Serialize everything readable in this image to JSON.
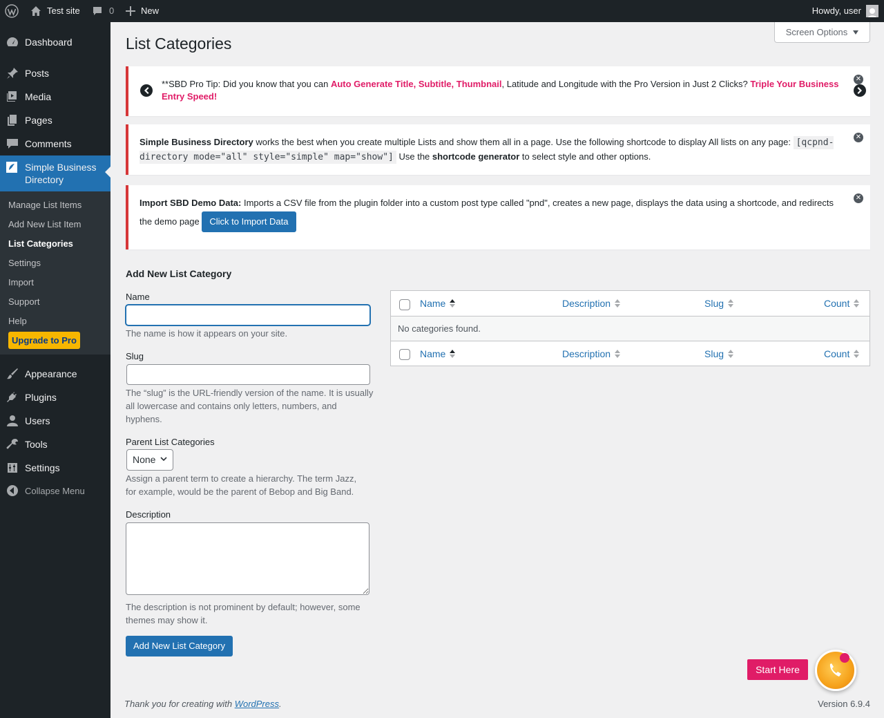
{
  "adminbar": {
    "site_name": "Test site",
    "comments_count": "0",
    "new_label": "New",
    "howdy": "Howdy, user"
  },
  "sidebar": {
    "items": [
      {
        "label": "Dashboard",
        "icon": "dashboard-icon"
      },
      {
        "label": "Posts",
        "icon": "pin-icon"
      },
      {
        "label": "Media",
        "icon": "media-icon"
      },
      {
        "label": "Pages",
        "icon": "pages-icon"
      },
      {
        "label": "Comments",
        "icon": "comment-icon"
      },
      {
        "label": "Simple Business Directory",
        "icon": "directory-icon"
      },
      {
        "label": "Appearance",
        "icon": "brush-icon"
      },
      {
        "label": "Plugins",
        "icon": "plug-icon"
      },
      {
        "label": "Users",
        "icon": "user-icon"
      },
      {
        "label": "Tools",
        "icon": "wrench-icon"
      },
      {
        "label": "Settings",
        "icon": "settings-icon"
      },
      {
        "label": "Collapse Menu",
        "icon": "collapse-icon"
      }
    ],
    "submenu": [
      "Manage List Items",
      "Add New List Item",
      "List Categories",
      "Settings",
      "Import",
      "Support",
      "Help"
    ],
    "upgrade_label": "Upgrade to Pro"
  },
  "screen_options": "Screen Options",
  "page_title": "List Categories",
  "notices": {
    "protip": {
      "prefix": "**SBD Pro Tip: Did you know that you can ",
      "highlight1": "Auto Generate Title, Subtitle, Thumbnail",
      "middle": ", Latitude and Longitude with the Pro Version in Just 2 Clicks? ",
      "highlight2": "Triple Your Business Entry Speed!"
    },
    "shortcode": {
      "strong": "Simple Business Directory",
      "text1": " works the best when you create multiple Lists and show them all in a page. Use the following shortcode to display All lists on any page: ",
      "code": "[qcpnd-directory mode=\"all\" style=\"simple\" map=\"show\"]",
      "text2": " Use the ",
      "strong2": "shortcode generator",
      "text3": " to select style and other options."
    },
    "import": {
      "strong": "Import SBD Demo Data:",
      "text": " Imports a CSV file from the plugin folder into a custom post type called \"pnd\", creates a new page, displays the data using a shortcode, and redirects the demo page ",
      "button": "Click to Import Data"
    }
  },
  "form": {
    "title": "Add New List Category",
    "name_label": "Name",
    "name_value": "",
    "name_help": "The name is how it appears on your site.",
    "slug_label": "Slug",
    "slug_value": "",
    "slug_help": "The “slug” is the URL-friendly version of the name. It is usually all lowercase and contains only letters, numbers, and hyphens.",
    "parent_label": "Parent List Categories",
    "parent_value": "None",
    "parent_help": "Assign a parent term to create a hierarchy. The term Jazz, for example, would be the parent of Bebop and Big Band.",
    "desc_label": "Description",
    "desc_value": "",
    "desc_help": "The description is not prominent by default; however, some themes may show it.",
    "submit": "Add New List Category"
  },
  "table": {
    "columns": [
      "Name",
      "Description",
      "Slug",
      "Count"
    ],
    "empty": "No categories found."
  },
  "footer": {
    "thanks_prefix": "Thank you for creating with ",
    "thanks_link": "WordPress",
    "thanks_suffix": ".",
    "version": "Version 6.9.4"
  },
  "start_here": "Start Here",
  "colors": {
    "admin_bg": "#1d2327",
    "accent": "#2271b1",
    "pink": "#e01c67",
    "notice_border": "#d63638"
  }
}
